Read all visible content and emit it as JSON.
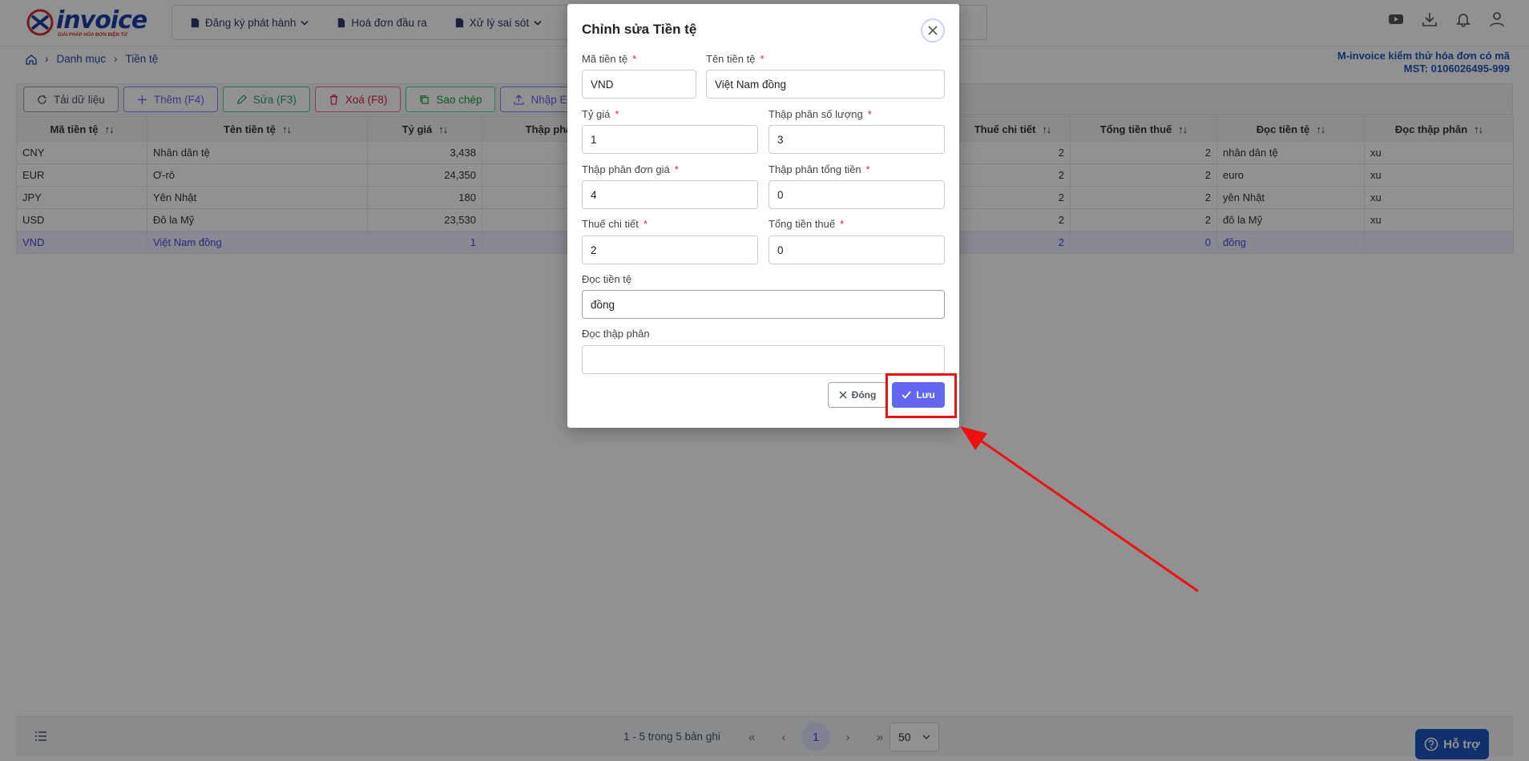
{
  "brand": {
    "logo_text": "invoice",
    "logo_tagline": "GIẢI PHÁP HÓA ĐƠN ĐIỆN TỬ"
  },
  "nav": {
    "items": [
      "Đăng ký phát hành",
      "Hoá đơn đầu ra",
      "Xử lý sai sót"
    ]
  },
  "breadcrumb": {
    "level1": "Danh mục",
    "level2": "Tiền tệ"
  },
  "company": {
    "name": "M-invoice kiểm thử hóa đơn có mã",
    "tax_code": "MST: 0106026495-999"
  },
  "toolbar": {
    "reload": "Tải dữ liệu",
    "add": "Thêm (F4)",
    "edit": "Sửa (F3)",
    "delete": "Xoá (F8)",
    "copy": "Sao chép",
    "import": "Nhập Excel"
  },
  "table": {
    "headers": [
      "Mã tiền tệ",
      "Tên tiền tệ",
      "Tỷ giá",
      "Thập phân số l",
      "",
      "Thuế chi tiết",
      "Tổng tiền thuế",
      "Đọc tiền tệ",
      "Đọc thập phân"
    ],
    "rows": [
      {
        "code": "CNY",
        "name": "Nhân dân tệ",
        "rate": "3,438",
        "tax_detail": "2",
        "tax_total": "2",
        "read": "nhân dân tệ",
        "read_dec": "xu"
      },
      {
        "code": "EUR",
        "name": "Ơ-rô",
        "rate": "24,350",
        "tax_detail": "2",
        "tax_total": "2",
        "read": "euro",
        "read_dec": "xu"
      },
      {
        "code": "JPY",
        "name": "Yên Nhật",
        "rate": "180",
        "tax_detail": "2",
        "tax_total": "2",
        "read": "yên Nhật",
        "read_dec": "xu"
      },
      {
        "code": "USD",
        "name": "Đô la Mỹ",
        "rate": "23,530",
        "tax_detail": "2",
        "tax_total": "2",
        "read": "đô la Mỹ",
        "read_dec": "xu"
      },
      {
        "code": "VND",
        "name": "Việt Nam đồng",
        "rate": "1",
        "tax_detail": "2",
        "tax_total": "0",
        "read": "đồng",
        "read_dec": ""
      }
    ]
  },
  "footer": {
    "page_info": "1 - 5 trong 5 bản ghi",
    "current_page": "1",
    "page_size": "50"
  },
  "support": {
    "label": "Hỗ trợ"
  },
  "modal": {
    "title": "Chỉnh sửa Tiền tệ",
    "fields": {
      "ma_tien_te": {
        "label": "Mã tiền tệ",
        "value": "VND"
      },
      "ten_tien_te": {
        "label": "Tên tiền tệ",
        "value": "Việt Nam đồng"
      },
      "ty_gia": {
        "label": "Tỷ giá",
        "value": "1"
      },
      "tp_so_luong": {
        "label": "Thập phân số lượng",
        "value": "3"
      },
      "tp_don_gia": {
        "label": "Thập phân đơn giá",
        "value": "4"
      },
      "tp_tong_tien": {
        "label": "Thập phân tổng tiền",
        "value": "0"
      },
      "thue_chi_tiet": {
        "label": "Thuế chi tiết",
        "value": "2"
      },
      "tong_tien_thue": {
        "label": "Tổng tiền thuế",
        "value": "0"
      },
      "doc_tien_te": {
        "label": "Đọc tiền tệ",
        "value": "đồng"
      },
      "doc_thap_phan": {
        "label": "Đọc thập phân",
        "value": ""
      }
    },
    "required_mark": "*",
    "cancel": "Đóng",
    "save": "Lưu"
  },
  "colors": {
    "primary": "#6366f1",
    "annotation": "#ee1111",
    "brand_blue": "#1f56c2"
  }
}
